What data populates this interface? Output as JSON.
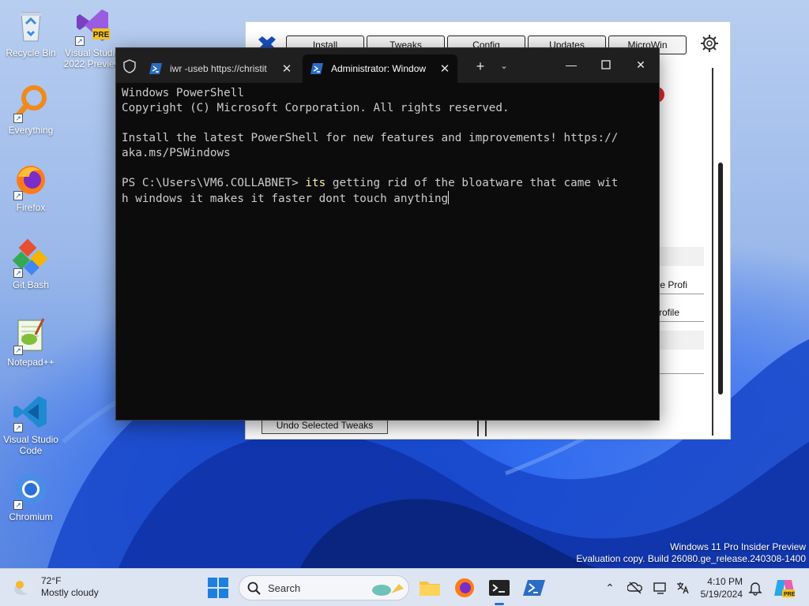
{
  "desktop": {
    "icons": [
      {
        "label": "Recycle Bin"
      },
      {
        "label": "Visual Studio 2022 Preview",
        "badge": "PRE"
      },
      {
        "label": "Everything"
      },
      {
        "label": "Firefox"
      },
      {
        "label": "Git Bash"
      },
      {
        "label": "Notepad++"
      },
      {
        "label": "Visual Studio Code"
      },
      {
        "label": "Chromium"
      }
    ],
    "watermark_line1": "Windows 11 Pro Insider Preview",
    "watermark_line2": "Evaluation copy. Build 26080.ge_release.240308-1400"
  },
  "winutil": {
    "tabs": [
      "Install",
      "Tweaks",
      "Config",
      "Updates",
      "MicroWin"
    ],
    "rows": [
      "ance Profi",
      "e Profile",
      "",
      "t"
    ],
    "undo_button": "Undo Selected Tweaks"
  },
  "terminal": {
    "tab1_title": "iwr -useb https://christit",
    "tab2_title": "Administrator: Window",
    "lines": [
      "Windows PowerShell",
      "Copyright (C) Microsoft Corporation. All rights reserved.",
      "",
      "Install the latest PowerShell for new features and improvements! https://",
      "aka.ms/PSWindows",
      ""
    ],
    "prompt": "PS C:\\Users\\VM6.COLLABNET> ",
    "command_word": "its",
    "command_rest_1": " getting rid of the bloatware that came wit",
    "command_rest_2": "h windows it makes it faster dont touch anything"
  },
  "taskbar": {
    "weather_temp": "72°F",
    "weather_desc": "Mostly cloudy",
    "search_placeholder": "Search",
    "time": "4:10 PM",
    "date": "5/19/2024"
  },
  "colors": {
    "accent": "#2a6fd6",
    "terminal_bg": "#0c0c0c",
    "terminal_text": "#cccccc",
    "command_highlight": "#f9f1a5"
  }
}
